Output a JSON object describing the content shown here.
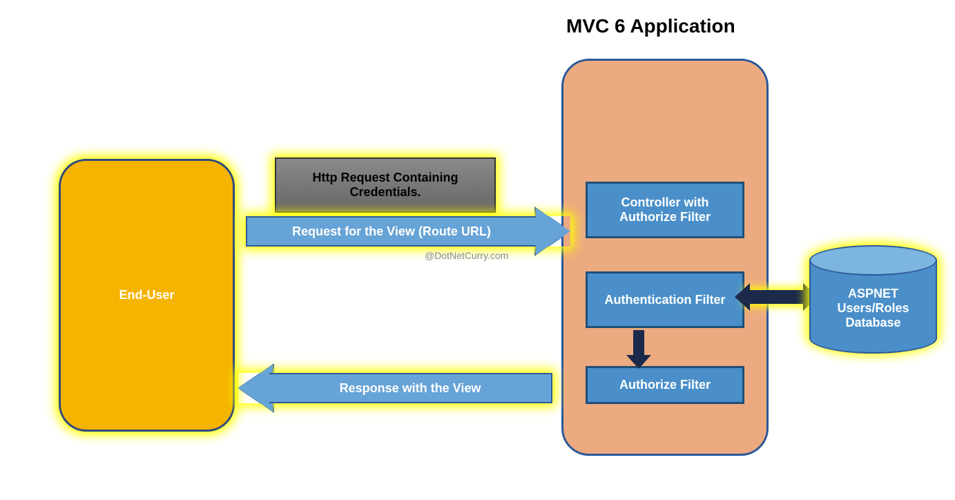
{
  "title": "MVC 6 Application",
  "endUser": "End-User",
  "greyBox": "Http Request Containing Credentials.",
  "requestArrow": "Request for the View (Route URL)",
  "responseArrow": "Response with the View",
  "watermark": "@DotNetCurry.com",
  "mvc": {
    "controller": "Controller with Authorize Filter",
    "auth": "Authentication Filter",
    "authorize": "Authorize Filter"
  },
  "db": "ASPNET Users/Roles Database"
}
